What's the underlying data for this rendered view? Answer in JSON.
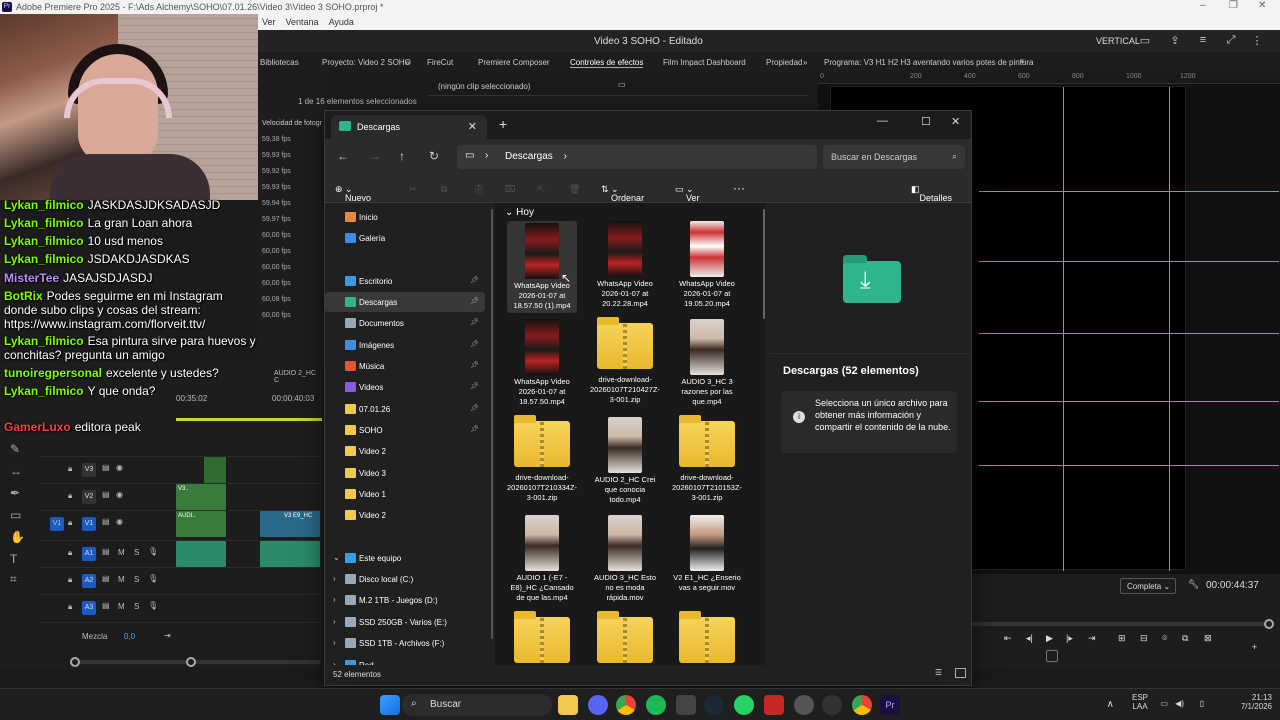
{
  "premiere": {
    "title": "Adobe Premiere Pro 2025 - F:\\Ads Alchemy\\SOHO\\07.01.26\\Video 3\\Video 3 SOHO.prproj *",
    "menu": [
      "Ver",
      "Ventana",
      "Ayuda"
    ],
    "workspace_name": "Video 3 SOHO - Editado",
    "workspace_mode": "VERTICAL",
    "panel_tabs": [
      "Bibliotecas",
      "Proyecto: Video 2 SOHO",
      "FireCut",
      "Premiere Composer",
      "Controles de efectos",
      "Film Impact Dashboard",
      "Propiedad"
    ],
    "program_tab": "Programa: V3 H1 H2 H3 aventando varios potes de pintura",
    "ruler_marks": [
      "0",
      "200",
      "400",
      "600",
      "800",
      "1000",
      "1200"
    ],
    "selected_count": "1 de 16 elementos seleccionados",
    "no_clip": "(ningún clip seleccionado)",
    "fps_header": "Velocidad de fotogr",
    "fps_values": [
      "59,38 fps",
      "59,93 fps",
      "59,92 fps",
      "59,93 fps",
      "59,94 fps",
      "59,97 fps",
      "60,00 fps",
      "60,00 fps",
      "60,00 fps",
      "60,00 fps",
      "60,08 fps",
      "60,00 fps"
    ],
    "timecode_left": "00:35:02",
    "timecode_mid": "00:00:40:03",
    "audio_label": "AUDIO 2_HC C",
    "tracks": [
      {
        "name": "V3",
        "target": false
      },
      {
        "name": "V2",
        "target": false
      },
      {
        "name": "V1",
        "target": true
      },
      {
        "name": "A1",
        "target": true
      },
      {
        "name": "A2",
        "target": true
      },
      {
        "name": "A3",
        "target": true
      }
    ],
    "mix_label": "Mezcla",
    "mix_value": "0,0",
    "clip_labels": [
      "V3..",
      "AUDI..",
      "V3 E9_HC"
    ],
    "quality": "Completa",
    "program_timecode": "00:00:44:37"
  },
  "chat": [
    {
      "user": "Lykan_filmico",
      "color": "#7cfc00",
      "text": "JASKDASJDKSADASJD"
    },
    {
      "user": "Lykan_filmico",
      "color": "#7cfc00",
      "text": "La gran Loan ahora"
    },
    {
      "user": "Lykan_filmico",
      "color": "#7cfc00",
      "text": "10 usd menos"
    },
    {
      "user": "Lykan_filmico",
      "color": "#7cfc00",
      "text": "JSDAKDJASDKAS"
    },
    {
      "user": "MisterTee",
      "color": "#b98cff",
      "text": "JASAJSDJASDJ"
    },
    {
      "user": "BotRix",
      "color": "#7cfc00",
      "text": "Podes seguirme en mi Instagram donde subo clips y cosas del stream: https://www.instagram.com/florveit.ttv/"
    },
    {
      "user": "Lykan_filmico",
      "color": "#7cfc00",
      "text": "Esa pintura sirve para huevos y conchitas? pregunta un amigo"
    },
    {
      "user": "tunoiregpersonal",
      "color": "#7cfc00",
      "text": "excelente y ustedes?"
    },
    {
      "user": "Lykan_filmico",
      "color": "#7cfc00",
      "text": "Y que onda?"
    },
    {
      "user": "GamerLuxo",
      "color": "#ff3b3b",
      "text": "editora peak"
    }
  ],
  "explorer": {
    "tab_title": "Descargas",
    "breadcrumb": "Descargas",
    "search_placeholder": "Buscar en Descargas",
    "cmd": {
      "new": "Nuevo",
      "sort": "Ordenar",
      "view": "Ver",
      "more": "···",
      "details": "Detalles"
    },
    "nav": [
      {
        "label": "Inicio",
        "icon": "home-icon",
        "color": "#e58a3a",
        "pinned": false
      },
      {
        "label": "Galería",
        "icon": "gallery-icon",
        "color": "#3a8ee5",
        "pinned": false
      },
      {
        "label": "Escritorio",
        "icon": "desktop-icon",
        "color": "#3a9be5",
        "pinned": true
      },
      {
        "label": "Descargas",
        "icon": "download-icon",
        "color": "#2fb58e",
        "pinned": true
      },
      {
        "label": "Documentos",
        "icon": "documents-icon",
        "color": "#9aa9b8",
        "pinned": true
      },
      {
        "label": "Imágenes",
        "icon": "pictures-icon",
        "color": "#3a8ee5",
        "pinned": true
      },
      {
        "label": "Música",
        "icon": "music-icon",
        "color": "#e5533a",
        "pinned": true
      },
      {
        "label": "Videos",
        "icon": "videos-icon",
        "color": "#8a5ae5",
        "pinned": true
      },
      {
        "label": "07.01.26",
        "icon": "folder-icon",
        "color": "#f2c94c",
        "pinned": true
      },
      {
        "label": "SOHO",
        "icon": "folder-icon",
        "color": "#f2c94c",
        "pinned": true
      },
      {
        "label": "Video 2",
        "icon": "folder-icon",
        "color": "#f2c94c",
        "pinned": false
      },
      {
        "label": "Video 3",
        "icon": "folder-icon",
        "color": "#f2c94c",
        "pinned": false
      },
      {
        "label": "Video 1",
        "icon": "folder-icon",
        "color": "#f2c94c",
        "pinned": false
      },
      {
        "label": "Video 2",
        "icon": "folder-icon",
        "color": "#f2c94c",
        "pinned": false
      },
      {
        "label": "Este equipo",
        "icon": "pc-icon",
        "color": "#3a9be5",
        "pinned": false
      },
      {
        "label": "Disco local (C:)",
        "icon": "drive-icon",
        "color": "#9aa9b8",
        "pinned": false
      },
      {
        "label": "M.2 1TB - Juegos (D:)",
        "icon": "drive-icon",
        "color": "#9aa9b8",
        "pinned": false
      },
      {
        "label": "SSD 250GB - Varios (E:)",
        "icon": "drive-icon",
        "color": "#9aa9b8",
        "pinned": false
      },
      {
        "label": "SSD 1TB - Archivos (F:)",
        "icon": "drive-icon",
        "color": "#9aa9b8",
        "pinned": false
      },
      {
        "label": "Red",
        "icon": "network-icon",
        "color": "#3a9be5",
        "pinned": false
      }
    ],
    "group": "Hoy",
    "files": [
      {
        "name": "WhatsApp Video 2026-01-07 at 18.57.50 (1).mp4",
        "kind": "video-red"
      },
      {
        "name": "WhatsApp Video 2026-01-07 at 20.22.28.mp4",
        "kind": "video-red"
      },
      {
        "name": "WhatsApp Video 2026-01-07 at 19.05.20.mp4",
        "kind": "video-white"
      },
      {
        "name": "WhatsApp Video 2026-01-07 at 18.57.50.mp4",
        "kind": "video-red"
      },
      {
        "name": "drive-download-20260107T210427Z-3-001.zip",
        "kind": "zip"
      },
      {
        "name": "AUDIO 3_HC 3 razones por las que.mp4",
        "kind": "video-person"
      },
      {
        "name": "drive-download-20260107T210334Z-3-001.zip",
        "kind": "zip"
      },
      {
        "name": "AUDIO 2_HC Crei que conocia todo.mp4",
        "kind": "video-person"
      },
      {
        "name": "drive-download-20260107T210153Z-3-001.zip",
        "kind": "zip"
      },
      {
        "name": "AUDIO 1 (-E7 -E8)_HC ¿Cansado de que las.mp4",
        "kind": "video-person"
      },
      {
        "name": "AUDIO 3_HC Esto no es moda rápida.mov",
        "kind": "video-person"
      },
      {
        "name": "V2 E1_HC ¿Enserio vas a seguir.mov",
        "kind": "video-man"
      },
      {
        "name": "",
        "kind": "zip"
      },
      {
        "name": "",
        "kind": "zip"
      },
      {
        "name": "",
        "kind": "zip"
      }
    ],
    "details_title": "Descargas (52 elementos)",
    "details_info": "Selecciona un único archivo para obtener más información y compartir el contenido de la nube.",
    "status": "52 elementos"
  },
  "taskbar": {
    "search": "Buscar",
    "lang_top": "ESP",
    "lang_bottom": "LAA",
    "time": "21:13",
    "date": "7/1/2026"
  }
}
